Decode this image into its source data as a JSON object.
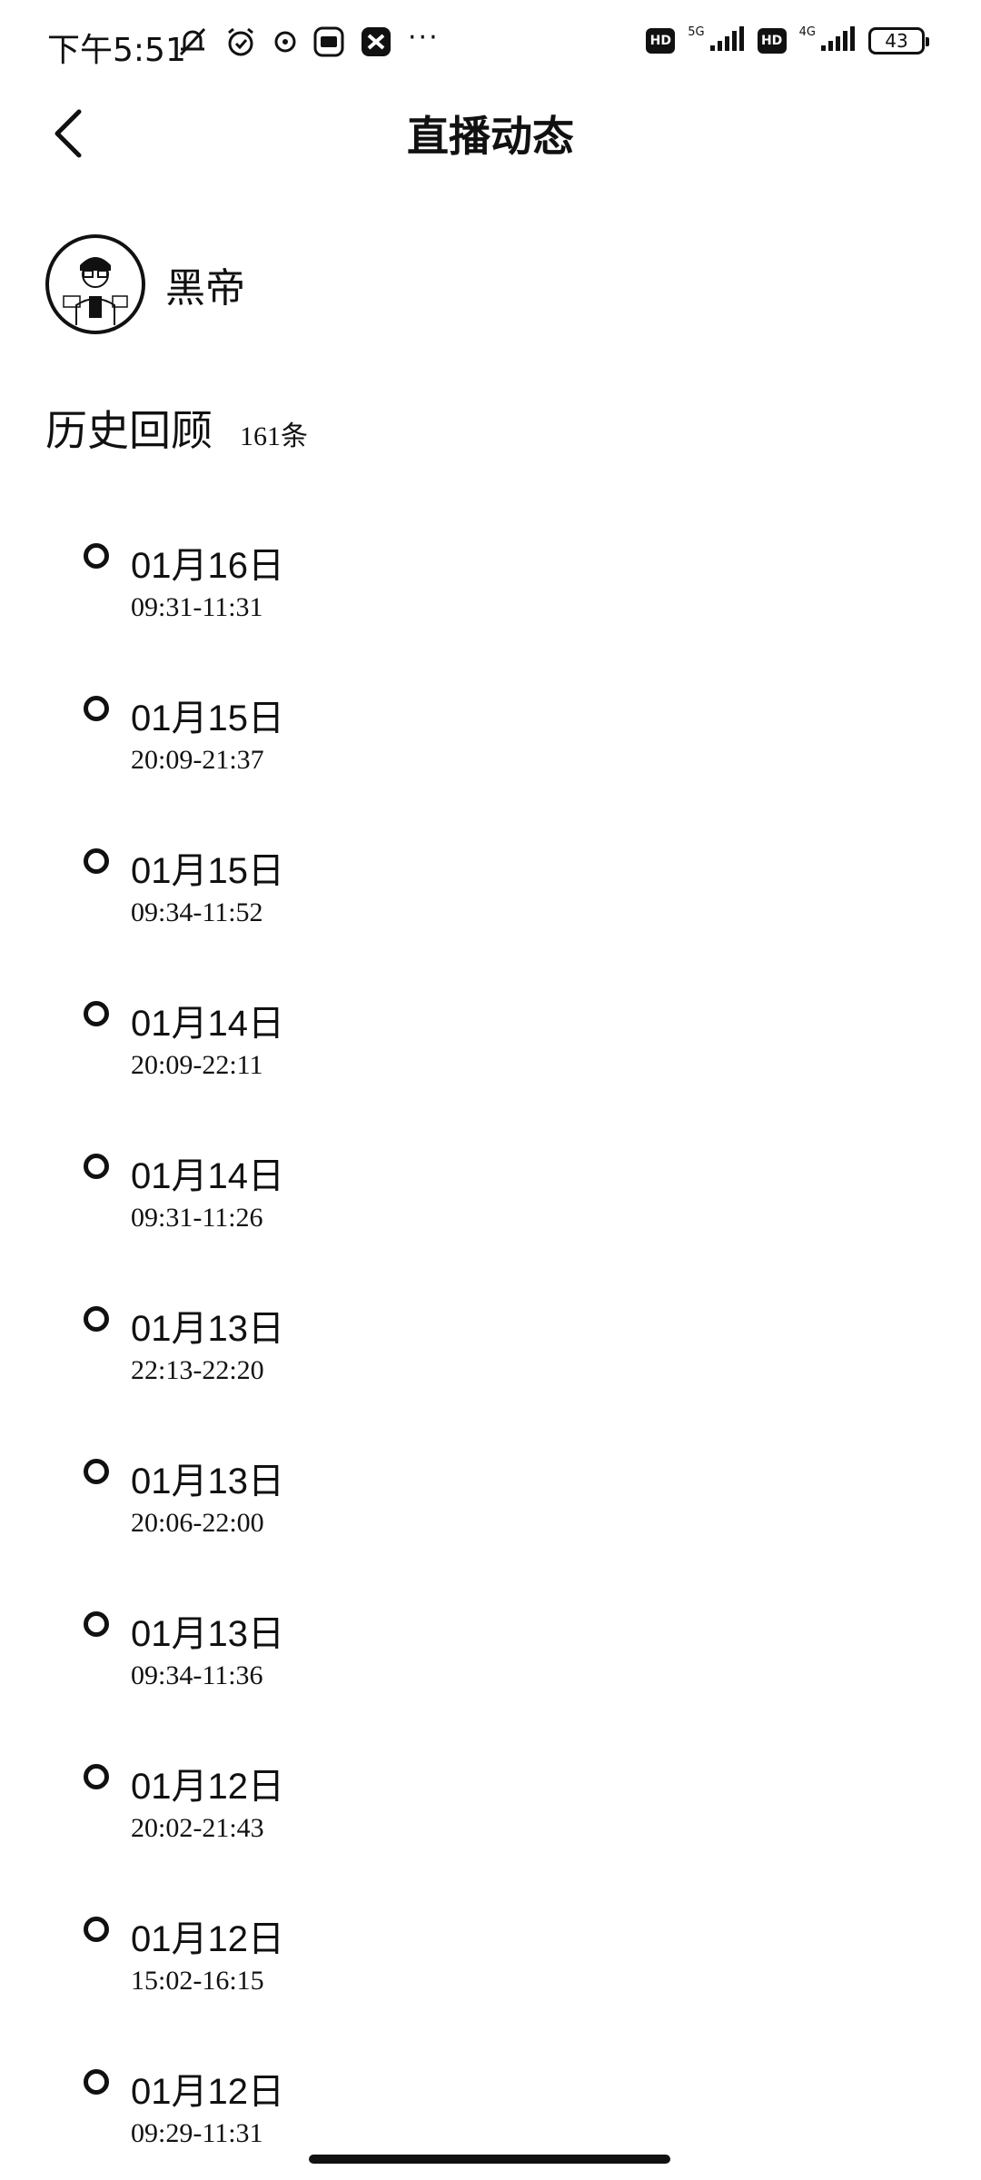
{
  "status_bar": {
    "time": "下午5:51",
    "network_5g": "5G",
    "network_4g": "4G",
    "hd": "HD",
    "battery": "43",
    "more": "···"
  },
  "header": {
    "title": "直播动态"
  },
  "profile": {
    "name": "黑帝"
  },
  "section": {
    "title": "历史回顾",
    "count": "161条"
  },
  "items": [
    {
      "date": "01月16日",
      "time": "09:31-11:31"
    },
    {
      "date": "01月15日",
      "time": "20:09-21:37"
    },
    {
      "date": "01月15日",
      "time": "09:34-11:52"
    },
    {
      "date": "01月14日",
      "time": "20:09-22:11"
    },
    {
      "date": "01月14日",
      "time": "09:31-11:26"
    },
    {
      "date": "01月13日",
      "time": "22:13-22:20"
    },
    {
      "date": "01月13日",
      "time": "20:06-22:00"
    },
    {
      "date": "01月13日",
      "time": "09:34-11:36"
    },
    {
      "date": "01月12日",
      "time": "20:02-21:43"
    },
    {
      "date": "01月12日",
      "time": "15:02-16:15"
    },
    {
      "date": "01月12日",
      "time": "09:29-11:31"
    }
  ]
}
